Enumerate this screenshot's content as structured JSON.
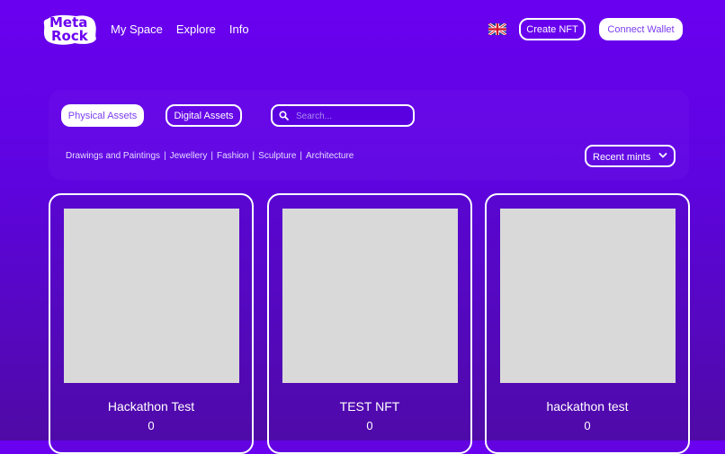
{
  "header": {
    "logo": {
      "line1": "Meta",
      "line2": "Rock"
    },
    "nav": [
      "My Space",
      "Explore",
      "Info"
    ],
    "language_icon": "uk-flag-icon",
    "create_label": "Create NFT",
    "connect_label": "Connect Wallet"
  },
  "filters": {
    "physical_label": "Physical Assets",
    "digital_label": "Digital Assets",
    "search_placeholder": "Search...",
    "categories": [
      "Drawings and Paintings",
      "Jewellery",
      "Fashion",
      "Sculpture",
      "Architecture"
    ],
    "sort_label": "Recent mints"
  },
  "cards": [
    {
      "title": "Hackathon Test",
      "count": "0"
    },
    {
      "title": "TEST NFT",
      "count": "0"
    },
    {
      "title": "hackathon test",
      "count": "0"
    }
  ],
  "colors": {
    "background_top": "#6a00f0",
    "background_bottom": "#4f0aa6",
    "image_placeholder": "#d9d9d9",
    "accent_text": "#7a3cf0"
  }
}
